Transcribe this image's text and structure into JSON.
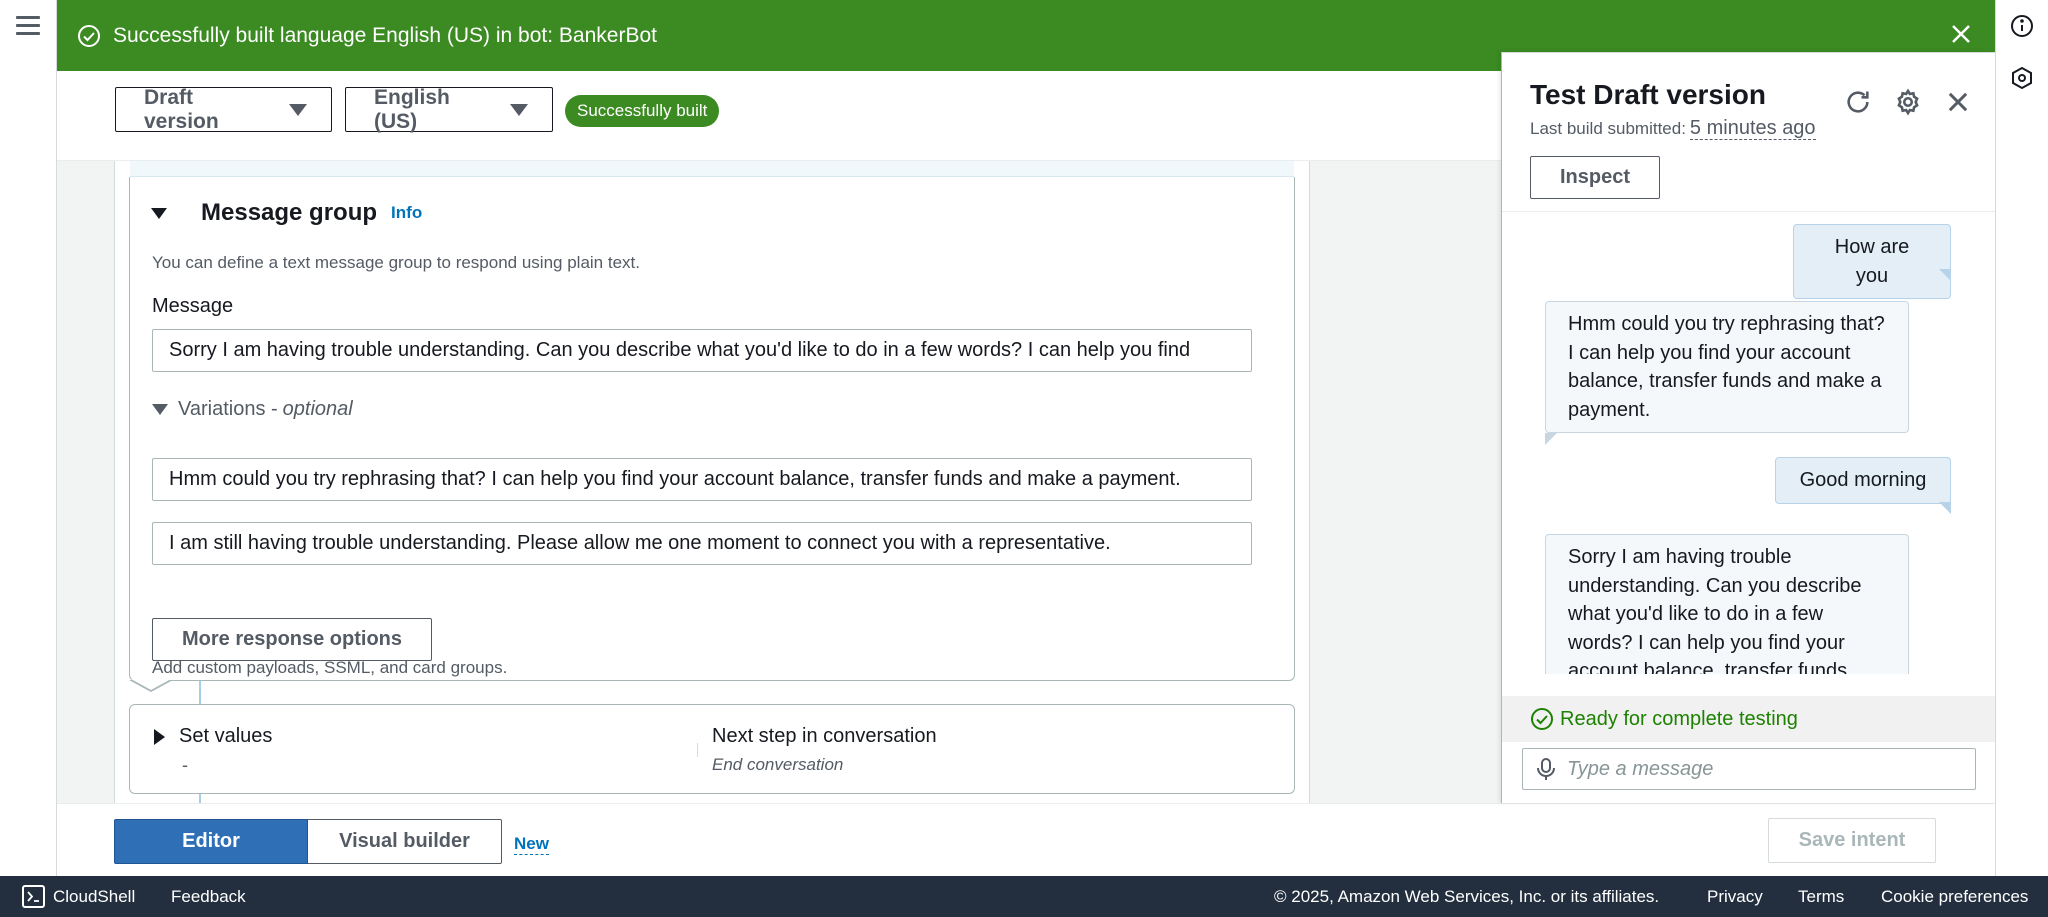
{
  "flash": {
    "message": "Successfully built language English (US) in bot: BankerBot",
    "status_color": "#3b8a22"
  },
  "toolbar": {
    "version_label": "Draft version",
    "language_label": "English (US)",
    "build_badge": "Successfully built"
  },
  "message_group": {
    "title": "Message group",
    "info_link": "Info",
    "description": "You can define a text message group to respond using plain text.",
    "message_label": "Message",
    "message_value": "Sorry I am having trouble understanding. Can you describe what you'd like to do in a few words? I can help you find",
    "variations_label": "Variations - ",
    "variations_optional": "optional",
    "variations": [
      "Hmm could you try rephrasing that? I can help you find your account balance, transfer funds and make a payment.",
      "I am still having trouble understanding. Please allow me one moment to connect you with a representative."
    ],
    "more_options_button": "More response options",
    "more_options_desc": "Add custom payloads, SSML, and card groups."
  },
  "set_values": {
    "label": "Set values",
    "value": "-",
    "next_step_label": "Next step in conversation",
    "next_step_value": "End conversation"
  },
  "bottom_bar": {
    "editor_tab": "Editor",
    "visual_builder_tab": "Visual builder",
    "new_badge": "New",
    "save_button": "Save intent",
    "accent_color": "#2f6fb6"
  },
  "test_panel": {
    "title": "Test Draft version",
    "last_build_label": "Last build submitted:",
    "last_build_time": "5 minutes ago",
    "inspect_button": "Inspect",
    "messages": [
      {
        "from": "user",
        "text": "How are you"
      },
      {
        "from": "bot",
        "text": "Hmm could you try rephrasing that? I can help you find your account balance, transfer funds and make a payment."
      },
      {
        "from": "user",
        "text": "Good morning"
      },
      {
        "from": "bot",
        "text": "Sorry I am having trouble understanding. Can you describe what you'd like to do in a few words? I can help you find your account balance, transfer funds"
      }
    ],
    "ready_status": "Ready for complete testing",
    "input_placeholder": "Type a message",
    "ready_color": "#1d8102"
  },
  "footer": {
    "cloudshell": "CloudShell",
    "feedback": "Feedback",
    "copyright": "© 2025, Amazon Web Services, Inc. or its affiliates.",
    "privacy": "Privacy",
    "terms": "Terms",
    "cookie_preferences": "Cookie preferences"
  },
  "icons": {
    "menu": "hamburger-menu-icon",
    "info": "info-circle-icon",
    "settings_rail": "gear-hex-icon",
    "refresh": "refresh-icon",
    "settings": "gear-icon",
    "close": "close-icon",
    "mic": "microphone-icon",
    "check": "check-circle-icon"
  }
}
